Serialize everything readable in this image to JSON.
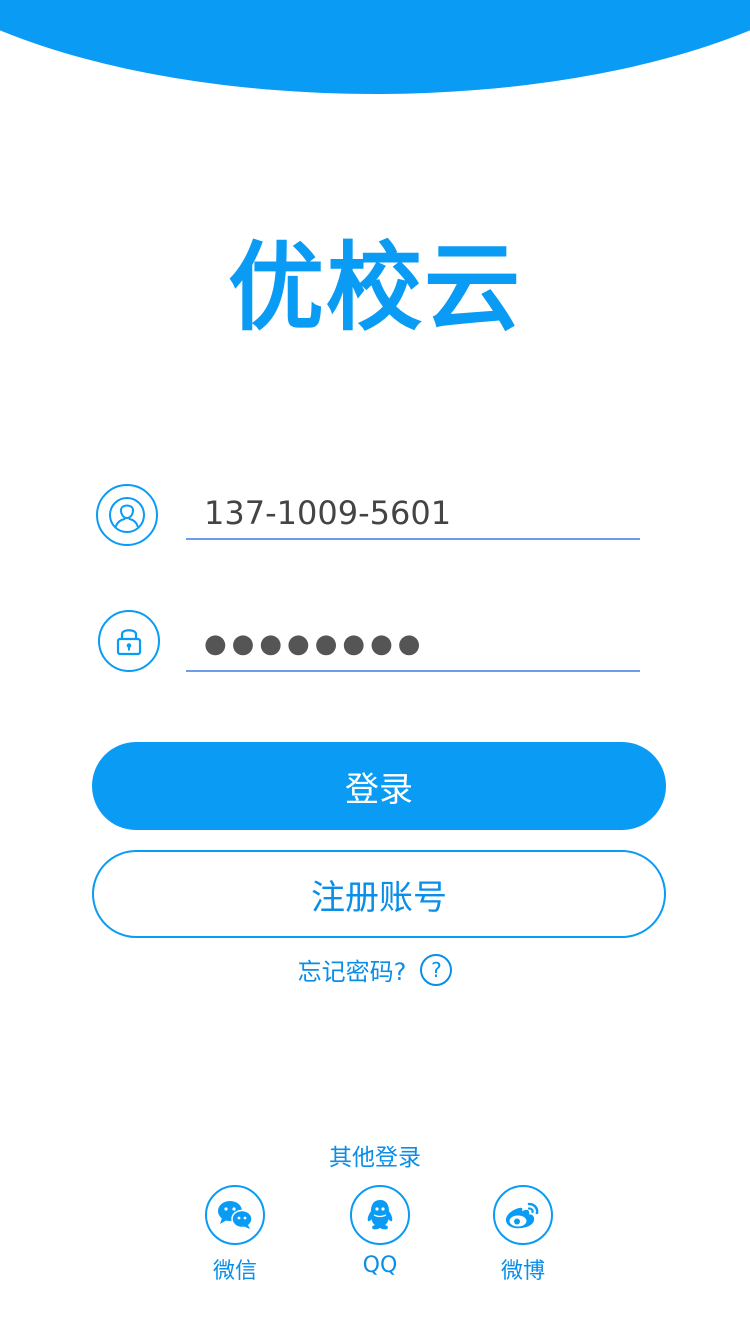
{
  "app": {
    "title": "优校云"
  },
  "login_form": {
    "phone_value": "137-1009-5601",
    "password_value": "●●●●●●●●"
  },
  "buttons": {
    "login_label": "登录",
    "register_label": "注册账号"
  },
  "forgot": {
    "label": "忘记密码?",
    "icon": "?"
  },
  "other_login": {
    "title": "其他登录",
    "items": [
      {
        "label": "微信",
        "icon": "wechat-icon"
      },
      {
        "label": "QQ",
        "icon": "qq-icon"
      },
      {
        "label": "微博",
        "icon": "weibo-icon"
      }
    ]
  },
  "colors": {
    "primary": "#0a9bf5",
    "underline": "#6f9be8",
    "text_dark": "#444444"
  }
}
